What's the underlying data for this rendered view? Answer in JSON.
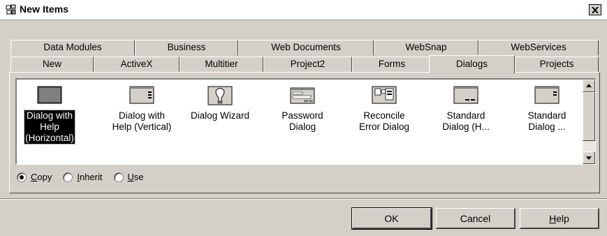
{
  "window": {
    "title": "New Items"
  },
  "tabs_back": [
    "Data Modules",
    "Business",
    "Web Documents",
    "WebSnap",
    "WebServices"
  ],
  "tabs_front": [
    "New",
    "ActiveX",
    "Multitier",
    "Project2",
    "Forms",
    "Dialogs",
    "Projects"
  ],
  "selected_tab": "Dialogs",
  "items": [
    {
      "label": "Dialog with\nHelp\n(Horizontal)",
      "icon": "dialog-horizontal-help-icon",
      "selected": true
    },
    {
      "label": "Dialog with\nHelp (Vertical)",
      "icon": "dialog-vertical-help-icon",
      "selected": false
    },
    {
      "label": "Dialog Wizard",
      "icon": "lightbulb-wizard-icon",
      "selected": false
    },
    {
      "label": "Password\nDialog",
      "icon": "password-dialog-icon",
      "selected": false
    },
    {
      "label": "Reconcile\nError Dialog",
      "icon": "reconcile-error-icon",
      "selected": false
    },
    {
      "label": "Standard\nDialog (H...",
      "icon": "standard-dialog-h-icon",
      "selected": false
    },
    {
      "label": "Standard\nDialog ...",
      "icon": "standard-dialog-v-icon",
      "selected": false
    }
  ],
  "options": [
    {
      "label": "Copy",
      "accel": "C",
      "rest": "opy",
      "checked": true
    },
    {
      "label": "Inherit",
      "accel": "I",
      "rest": "nherit",
      "checked": false
    },
    {
      "label": "Use",
      "accel": "U",
      "rest": "se",
      "checked": false
    }
  ],
  "buttons": {
    "ok": "OK",
    "cancel": "Cancel",
    "help_accel": "H",
    "help_rest": "elp"
  }
}
